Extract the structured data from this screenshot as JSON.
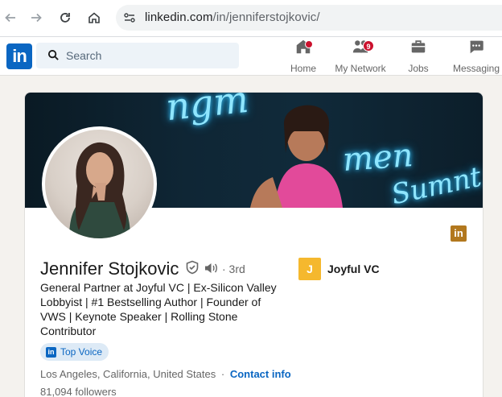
{
  "browser": {
    "url_host": "linkedin.com",
    "url_path": "/in/jenniferstojkovic/",
    "icons": [
      "back-arrow-icon",
      "forward-arrow-icon",
      "reload-icon",
      "home-icon",
      "site-settings-icon"
    ]
  },
  "linkedin_nav": {
    "logo": "in",
    "search_placeholder": "Search",
    "items": [
      {
        "label": "Home",
        "icon": "home-icon",
        "badge": ""
      },
      {
        "label": "My Network",
        "icon": "network-icon",
        "badge": "9"
      },
      {
        "label": "Jobs",
        "icon": "briefcase-icon",
        "badge": ""
      },
      {
        "label": "Messaging",
        "icon": "message-icon",
        "badge": ""
      }
    ]
  },
  "profile": {
    "name": "Jennifer Stojkovic",
    "degree": "· 3rd",
    "headline": "General Partner at Joyful VC | Ex-Silicon Valley Lobbyist | #1 Bestselling Author | Founder of VWS | Keynote Speaker | Rolling Stone Contributor",
    "company_logo": "J",
    "company": "Joyful VC",
    "top_voice": "Top Voice",
    "location": "Los Angeles, California, United States",
    "separator": "·",
    "contact_info": "Contact info",
    "followers": "81,094 followers",
    "linkedin_badge": "in"
  },
  "colors": {
    "linkedin_blue": "#0a66c2",
    "badge_red": "#cb112d",
    "company_yellow": "#f5b82e",
    "premium_gold": "#b2781e"
  }
}
